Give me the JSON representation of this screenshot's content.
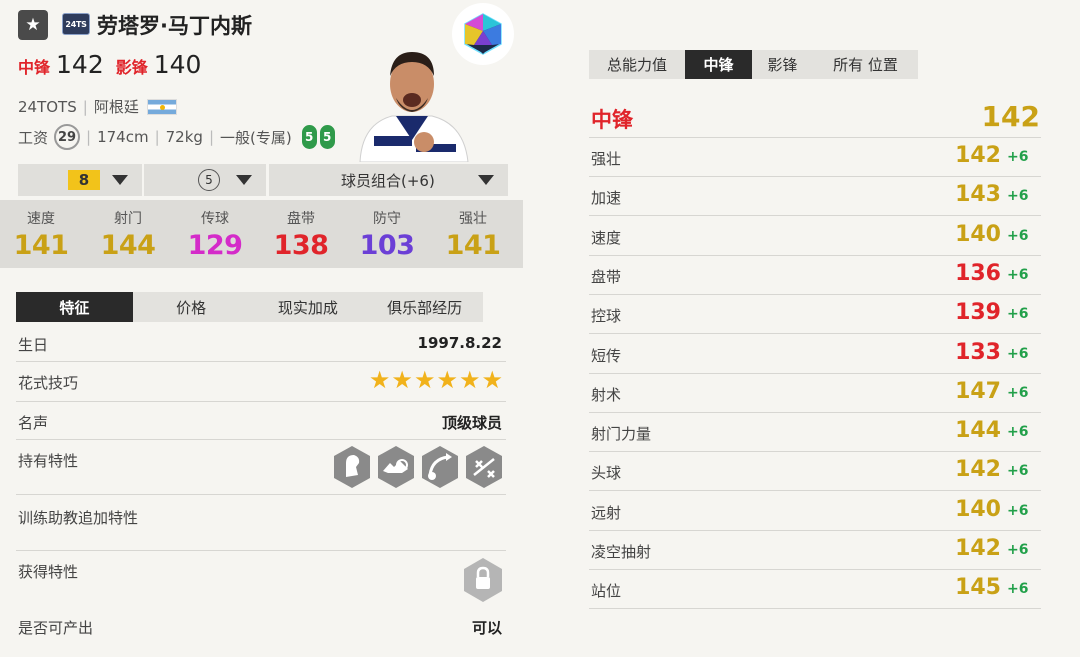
{
  "header": {
    "fav_icon": "star-icon",
    "season_badge": "24TS",
    "name": "劳塔罗·马丁内斯",
    "rank_icon": "icosahedron-rank-icon"
  },
  "ovr": [
    {
      "pos": "中锋",
      "val": "142"
    },
    {
      "pos": "影锋",
      "val": "140"
    }
  ],
  "info": {
    "season": "24TOTS",
    "nation": "阿根廷",
    "wage_label": "工资",
    "wage": "29",
    "height": "174cm",
    "weight": "72kg",
    "body_type": "一般(专属)",
    "left_foot": "5",
    "right_foot": "5"
  },
  "dropdowns": {
    "level": "8",
    "training": "5",
    "chemistry": "球员组合(+6)"
  },
  "stats": [
    {
      "label": "速度",
      "value": "141",
      "color": "#c9a116"
    },
    {
      "label": "射门",
      "value": "144",
      "color": "#c9a116"
    },
    {
      "label": "传球",
      "value": "129",
      "color": "#d42bc9"
    },
    {
      "label": "盘带",
      "value": "138",
      "color": "#e0242a"
    },
    {
      "label": "防守",
      "value": "103",
      "color": "#6b3fd6"
    },
    {
      "label": "强壮",
      "value": "141",
      "color": "#c9a116"
    }
  ],
  "left_tabs": [
    "特征",
    "价格",
    "现实加成",
    "俱乐部经历"
  ],
  "details": {
    "birthday_label": "生日",
    "birthday": "1997.8.22",
    "skill_label": "花式技巧",
    "skill_stars": 6,
    "fame_label": "名声",
    "fame": "顶级球员",
    "traits_label": "持有特性",
    "coach_label": "训练助教追加特性",
    "earned_label": "获得特性",
    "tradable_label": "是否可产出",
    "tradable": "可以"
  },
  "right_tabs": [
    "总能力值",
    "中锋",
    "影锋",
    "所有 位置"
  ],
  "position": {
    "title": "中锋",
    "total": "142"
  },
  "attributes": [
    {
      "label": "强壮",
      "value": "142",
      "bonus": "+6",
      "color": "#c9a116"
    },
    {
      "label": "加速",
      "value": "143",
      "bonus": "+6",
      "color": "#c9a116"
    },
    {
      "label": "速度",
      "value": "140",
      "bonus": "+6",
      "color": "#c9a116"
    },
    {
      "label": "盘带",
      "value": "136",
      "bonus": "+6",
      "color": "#e0242a"
    },
    {
      "label": "控球",
      "value": "139",
      "bonus": "+6",
      "color": "#e0242a"
    },
    {
      "label": "短传",
      "value": "133",
      "bonus": "+6",
      "color": "#e0242a"
    },
    {
      "label": "射术",
      "value": "147",
      "bonus": "+6",
      "color": "#c9a116"
    },
    {
      "label": "射门力量",
      "value": "144",
      "bonus": "+6",
      "color": "#c9a116"
    },
    {
      "label": "头球",
      "value": "142",
      "bonus": "+6",
      "color": "#c9a116"
    },
    {
      "label": "远射",
      "value": "140",
      "bonus": "+6",
      "color": "#c9a116"
    },
    {
      "label": "凌空抽射",
      "value": "142",
      "bonus": "+6",
      "color": "#c9a116"
    },
    {
      "label": "站位",
      "value": "145",
      "bonus": "+6",
      "color": "#c9a116"
    }
  ]
}
